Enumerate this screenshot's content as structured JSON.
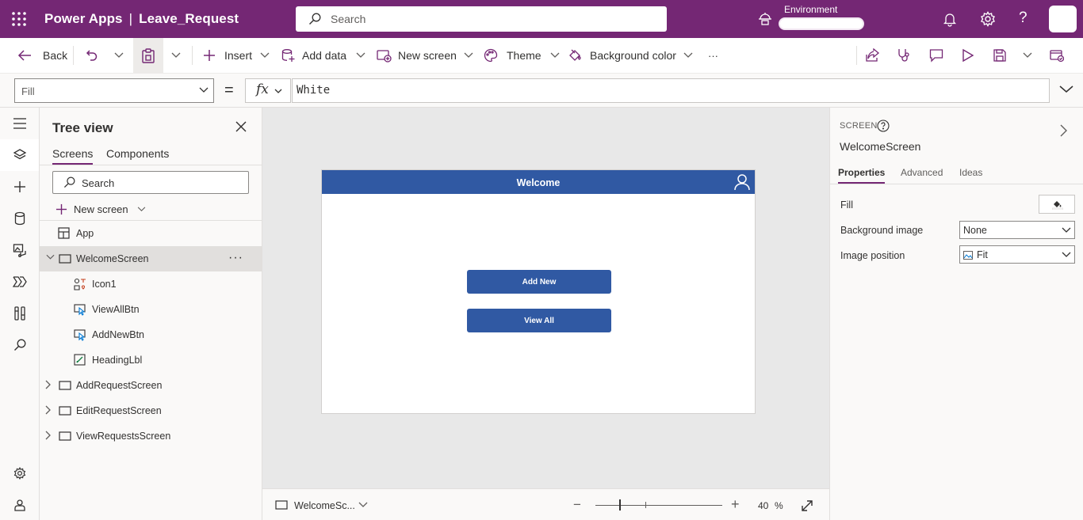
{
  "topbar": {
    "app_name": "Power Apps",
    "separator": "|",
    "project_name": "Leave_Request",
    "search_placeholder": "Search",
    "environment_label": "Environment",
    "environment_value": ""
  },
  "commandbar": {
    "back": "Back",
    "insert": "Insert",
    "add_data": "Add data",
    "new_screen": "New screen",
    "theme": "Theme",
    "background_color": "Background color",
    "more": "···"
  },
  "formulabar": {
    "property": "Fill",
    "equals": "=",
    "fx": "fx",
    "formula": "White"
  },
  "treeview": {
    "title": "Tree view",
    "tabs": {
      "screens": "Screens",
      "components": "Components"
    },
    "search_placeholder": "Search",
    "new_screen": "New screen",
    "more": "···",
    "nodes": [
      {
        "label": "App"
      },
      {
        "label": "WelcomeScreen"
      },
      {
        "label": "Icon1"
      },
      {
        "label": "ViewAllBtn"
      },
      {
        "label": "AddNewBtn"
      },
      {
        "label": "HeadingLbl"
      },
      {
        "label": "AddRequestScreen"
      },
      {
        "label": "EditRequestScreen"
      },
      {
        "label": "ViewRequestsScreen"
      }
    ]
  },
  "canvas": {
    "heading": "Welcome",
    "add_new_button": "Add New",
    "view_all_button": "View All",
    "header_color": "#3059a3",
    "bottom": {
      "screen_name": "WelcomeSc...",
      "zoom_value": "40",
      "zoom_unit": "%",
      "zoom_minus": "−",
      "zoom_plus": "+"
    }
  },
  "properties": {
    "type": "SCREEN",
    "name": "WelcomeScreen",
    "tabs": {
      "properties": "Properties",
      "advanced": "Advanced",
      "ideas": "Ideas"
    },
    "fill_label": "Fill",
    "background_image_label": "Background image",
    "background_image_value": "None",
    "image_position_label": "Image position",
    "image_position_value": "Fit"
  },
  "colors": {
    "brand": "#742774",
    "accent_blue": "#3059a3"
  }
}
